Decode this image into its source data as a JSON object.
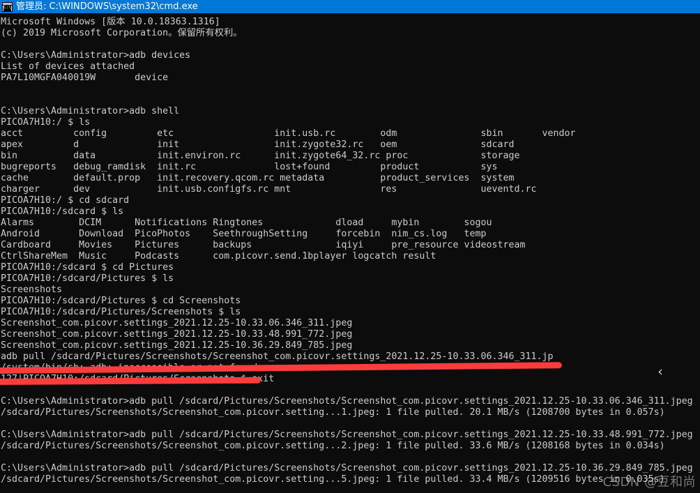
{
  "window": {
    "title": "管理员: C:\\WINDOWS\\system32\\cmd.exe",
    "icon": "cmd-icon",
    "icon_glyph": "C:\\",
    "titlebar_color": "#0078d7",
    "background_color": "#0c0c0c",
    "text_color": "#cccccc"
  },
  "annotations": {
    "red_color": "#fa3c3c",
    "strike_1_label": "red-strikethrough-over-failed-adb-pull-command",
    "strike_2_label": "red-strikethrough-over-inaccessible-error",
    "chevron": "‹",
    "watermark": "CSDN @豆和尚"
  },
  "console": {
    "lines": [
      "Microsoft Windows [版本 10.0.18363.1316]",
      "(c) 2019 Microsoft Corporation。保留所有权利。",
      "",
      "C:\\Users\\Administrator>adb devices",
      "List of devices attached",
      "PA7L10MGFA040019W       device",
      "",
      "",
      "C:\\Users\\Administrator>adb shell",
      "PICOA7H10:/ $ ls",
      "acct         config         etc                  init.usb.rc        odm               sbin       vendor",
      "apex         d              init                 init.zygote32.rc   oem               sdcard",
      "bin          data           init.environ.rc      init.zygote64_32.rc proc             storage",
      "bugreports   debug_ramdisk  init.rc              lost+found         product           sys",
      "cache        default.prop   init.recovery.qcom.rc metadata          product_services  system",
      "charger      dev            init.usb.configfs.rc mnt                res               ueventd.rc",
      "PICOA7H10:/ $ cd sdcard",
      "PICOA7H10:/sdcard $ ls",
      "Alarms        DCIM      Notifications Ringtones             dload     mybin        sogou",
      "Android       Download  PicoPhotos    SeethroughSetting     forcebin  nim_cs.log   temp",
      "Cardboard     Movies    Pictures      backups               iqiyi     pre_resource videostream",
      "CtrlShareMem  Music     Podcasts      com.picovr.send.1bplayer logcatch result",
      "PICOA7H10:/sdcard $ cd Pictures",
      "PICOA7H10:/sdcard/Pictures $ ls",
      "Screenshots",
      "PICOA7H10:/sdcard/Pictures $ cd Screenshots",
      "PICOA7H10:/sdcard/Pictures/Screenshots $ ls",
      "Screenshot_com.picovr.settings_2021.12.25-10.33.06.346_311.jpeg",
      "Screenshot_com.picovr.settings_2021.12.25-10.33.48.991_772.jpeg",
      "Screenshot_com.picovr.settings_2021.12.25-10.36.29.849_785.jpeg",
      "adb pull /sdcard/Pictures/Screenshots/Screenshot_com.picovr.settings_2021.12.25-10.33.06.346_311.jp",
      "/system/bin/sh: adb: inaccessible or not found",
      "127|PICOA7H10:/sdcard/Pictures/Screenshots $ exit",
      "",
      "C:\\Users\\Administrator>adb pull /sdcard/Pictures/Screenshots/Screenshot_com.picovr.settings_2021.12.25-10.33.06.346_311.jpeg",
      "/sdcard/Pictures/Screenshots/Screenshot_com.picovr.setting...1.jpeg: 1 file pulled. 20.1 MB/s (1208700 bytes in 0.057s)",
      "",
      "C:\\Users\\Administrator>adb pull /sdcard/Pictures/Screenshots/Screenshot_com.picovr.settings_2021.12.25-10.33.48.991_772.jpeg",
      "/sdcard/Pictures/Screenshots/Screenshot_com.picovr.setting...2.jpeg: 1 file pulled. 33.6 MB/s (1208168 bytes in 0.034s)",
      "",
      "C:\\Users\\Administrator>adb pull /sdcard/Pictures/Screenshots/Screenshot_com.picovr.settings_2021.12.25-10.36.29.849_785.jpeg",
      "/sdcard/Pictures/Screenshots/Screenshot_com.picovr.setting...5.jpeg: 1 file pulled. 33.4 MB/s (1209516 bytes in 0.035s)"
    ]
  }
}
